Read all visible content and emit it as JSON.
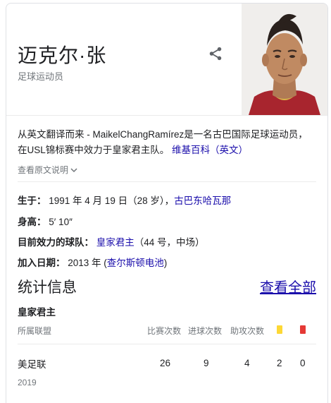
{
  "player": {
    "name": "迈克尔·张",
    "role": "足球运动员"
  },
  "description": {
    "text": "从英文翻译而来 - MaikelChangRamírez是一名古巴国际足球运动员，在USL锦标赛中效力于皇家君主队。",
    "source_link": "维基百科（英文）",
    "show_original": "查看原文说明"
  },
  "facts": {
    "birth_label": "生于：",
    "birth_value": "1991 年 4 月 19 日（28 岁），",
    "birth_place": "古巴东哈瓦那",
    "height_label": "身高：",
    "height_value": "5′ 10″",
    "team_label": "目前效力的球队：",
    "team_link": "皇家君主",
    "team_rest": "（44 号，中场）",
    "joined_label": "加入日期：",
    "joined_value": "2013 年 (",
    "joined_link": "查尔斯顿电池",
    "joined_close": ")"
  },
  "stats": {
    "title": "统计信息",
    "see_all": "查看全部",
    "team": "皇家君主",
    "headers": {
      "league": "所属联盟",
      "matches": "比赛次数",
      "goals": "进球次数",
      "assists": "助攻次数"
    },
    "row": {
      "league": "美足联",
      "year": "2019",
      "matches": "26",
      "goals": "9",
      "assists": "4",
      "yellow": "2",
      "red": "0"
    }
  },
  "colors": {
    "link": "#1a0dab",
    "yellow_card": "#fdd835",
    "red_card": "#e53935"
  }
}
